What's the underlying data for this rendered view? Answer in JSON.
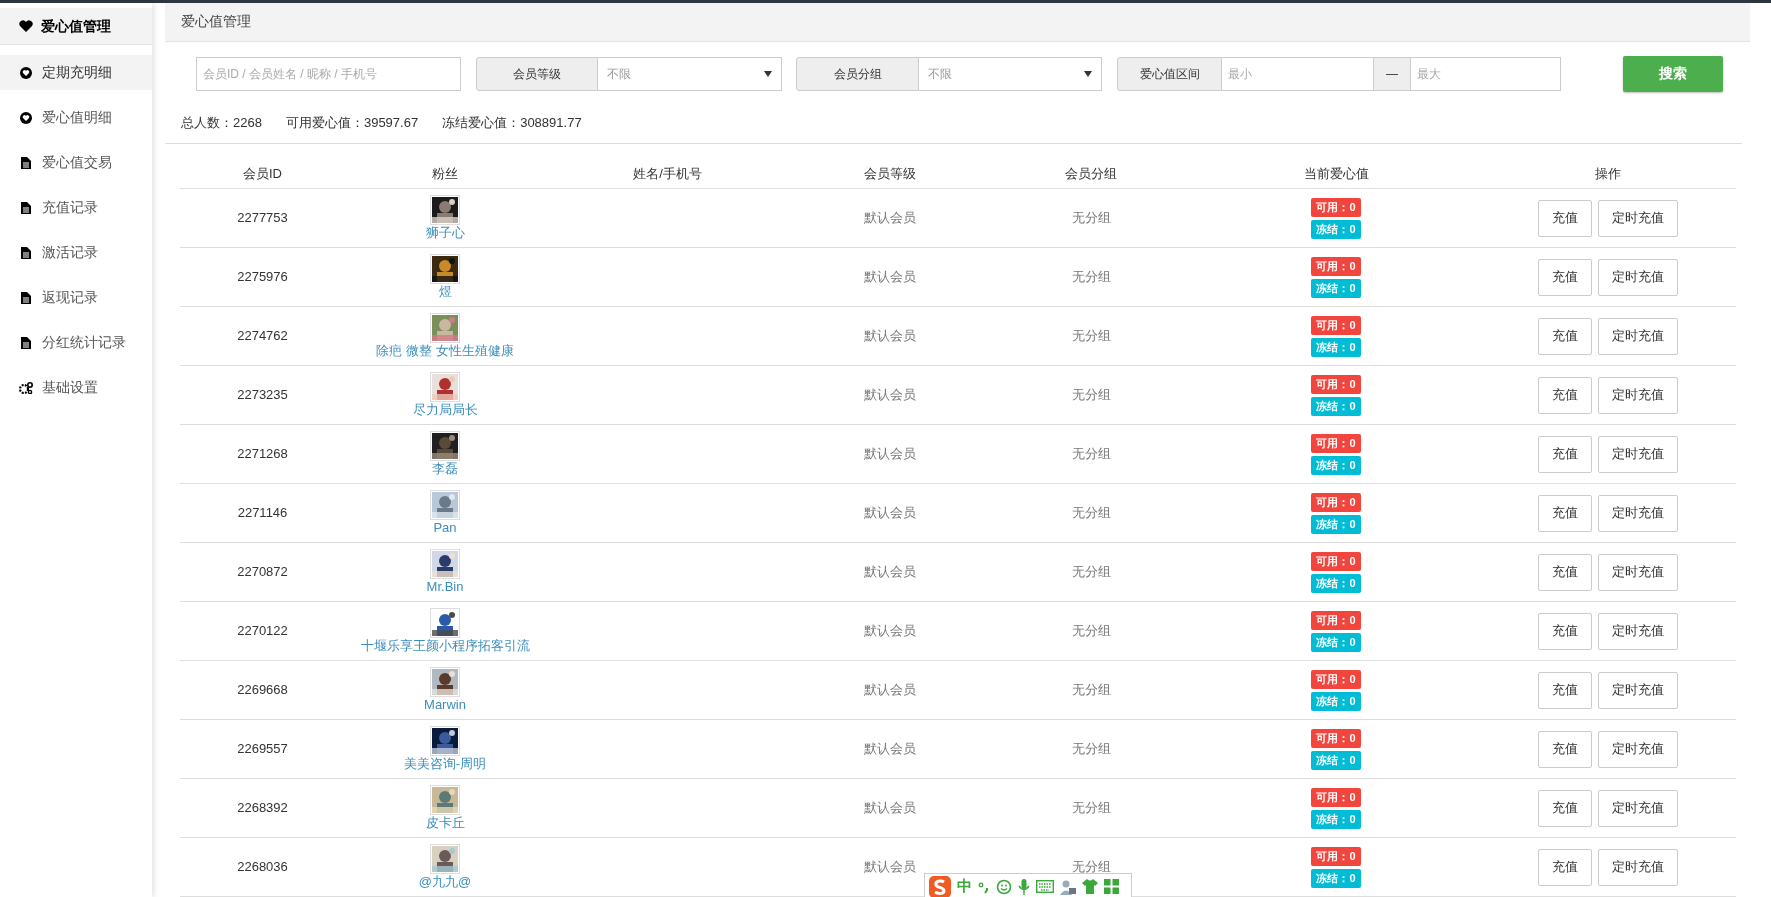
{
  "sidebar": {
    "title": "爱心值管理",
    "items": [
      {
        "label": "定期充明细",
        "kind": "heart",
        "selected": true
      },
      {
        "label": "爱心值明细",
        "kind": "heart",
        "selected": false
      },
      {
        "label": "爱心值交易",
        "kind": "record",
        "selected": false
      },
      {
        "label": "充值记录",
        "kind": "record",
        "selected": false
      },
      {
        "label": "激活记录",
        "kind": "record",
        "selected": false
      },
      {
        "label": "返现记录",
        "kind": "record",
        "selected": false
      },
      {
        "label": "分红统计记录",
        "kind": "record",
        "selected": false
      },
      {
        "label": "基础设置",
        "kind": "settings",
        "selected": false
      }
    ]
  },
  "page_title": "爱心值管理",
  "filters": {
    "search": {
      "placeholder": "会员ID / 会员姓名 / 昵称 / 手机号"
    },
    "level": {
      "label": "会员等级",
      "value": "不限"
    },
    "group": {
      "label": "会员分组",
      "value": "不限"
    },
    "range": {
      "label": "爱心值区间",
      "min_placeholder": "最小",
      "separator": "—",
      "max_placeholder": "最大"
    },
    "search_button": "搜索"
  },
  "stats": [
    {
      "label": "总人数：",
      "value": "2268"
    },
    {
      "label": "可用爱心值：",
      "value": "39597.67"
    },
    {
      "label": "冻结爱心值：",
      "value": "308891.77"
    }
  ],
  "table": {
    "columns": [
      "会员ID",
      "粉丝",
      "姓名/手机号",
      "会员等级",
      "会员分组",
      "当前爱心值",
      "操作"
    ],
    "rows": [
      {
        "id": "2277753",
        "fan": "狮子心",
        "level": "默认会员",
        "group": "无分组",
        "available": "可用：0",
        "frozen": "冻结：0",
        "actions": [
          "充值",
          "定时充值"
        ]
      },
      {
        "id": "2275976",
        "fan": "煜",
        "level": "默认会员",
        "group": "无分组",
        "available": "可用：0",
        "frozen": "冻结：0",
        "actions": [
          "充值",
          "定时充值"
        ]
      },
      {
        "id": "2274762",
        "fan": "除疤 微整 女性生殖健康",
        "level": "默认会员",
        "group": "无分组",
        "available": "可用：0",
        "frozen": "冻结：0",
        "actions": [
          "充值",
          "定时充值"
        ]
      },
      {
        "id": "2273235",
        "fan": "尽力局局长",
        "level": "默认会员",
        "group": "无分组",
        "available": "可用：0",
        "frozen": "冻结：0",
        "actions": [
          "充值",
          "定时充值"
        ]
      },
      {
        "id": "2271268",
        "fan": "李磊",
        "level": "默认会员",
        "group": "无分组",
        "available": "可用：0",
        "frozen": "冻结：0",
        "actions": [
          "充值",
          "定时充值"
        ]
      },
      {
        "id": "2271146",
        "fan": "Pan",
        "level": "默认会员",
        "group": "无分组",
        "available": "可用：0",
        "frozen": "冻结：0",
        "actions": [
          "充值",
          "定时充值"
        ]
      },
      {
        "id": "2270872",
        "fan": "Mr.Bin",
        "level": "默认会员",
        "group": "无分组",
        "available": "可用：0",
        "frozen": "冻结：0",
        "actions": [
          "充值",
          "定时充值"
        ]
      },
      {
        "id": "2270122",
        "fan": "十堰乐享王颜小程序拓客引流",
        "level": "默认会员",
        "group": "无分组",
        "available": "可用：0",
        "frozen": "冻结：0",
        "actions": [
          "充值",
          "定时充值"
        ]
      },
      {
        "id": "2269668",
        "fan": "Marwin",
        "level": "默认会员",
        "group": "无分组",
        "available": "可用：0",
        "frozen": "冻结：0",
        "actions": [
          "充值",
          "定时充值"
        ]
      },
      {
        "id": "2269557",
        "fan": "美美咨询-周明",
        "level": "默认会员",
        "group": "无分组",
        "available": "可用：0",
        "frozen": "冻结：0",
        "actions": [
          "充值",
          "定时充值"
        ]
      },
      {
        "id": "2268392",
        "fan": "皮卡丘",
        "level": "默认会员",
        "group": "无分组",
        "available": "可用：0",
        "frozen": "冻结：0",
        "actions": [
          "充值",
          "定时充值"
        ]
      },
      {
        "id": "2268036",
        "fan": "@九九@",
        "level": "默认会员",
        "group": "无分组",
        "available": "可用：0",
        "frozen": "冻结：0",
        "actions": [
          "充值",
          "定时充值"
        ]
      }
    ]
  },
  "ime_toolbar": {
    "mode": "中"
  }
}
